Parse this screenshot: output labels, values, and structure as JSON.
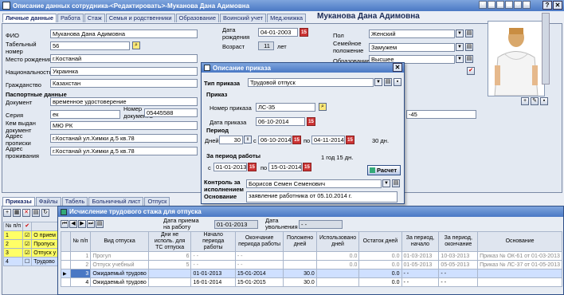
{
  "main_title": "Описание данных сотрудника-<Редактировать>-Муканова Дана Адимовна",
  "employee_header": "Муканова Дана Адимовна",
  "tabs": [
    "Личные данные",
    "Работа",
    "Стаж",
    "Семья и родственники",
    "Образование",
    "Воинский учет",
    "Мед.книжка"
  ],
  "personal": {
    "fio_label": "ФИО",
    "fio": "Муканова Дана Адимовна",
    "tabnum_label": "Табельный номер",
    "tabnum": "56",
    "birthplace_label": "Место рождения",
    "birthplace": "г.Костанай",
    "nation_label": "Национальность",
    "nation": "Украинка",
    "citizen_label": "Гражданство",
    "citizen": "Казахстан",
    "passport_header": "Паспортные данные",
    "doc_label": "Документ",
    "doc": "временное удостоверение",
    "series_label": "Серия",
    "series": "ек",
    "docnum_label": "Номер документа",
    "docnum": "05445588",
    "issuer_label": "Кем выдан документ",
    "issuer": "МЮ РК",
    "reg_label": "Адрес прописки",
    "reg": "г.Костанай ул.Химки д.5 кв.78",
    "live_label": "Адрес проживания",
    "live": "г.Костанай ул.Химки д.5 кв.78",
    "dob_label": "Дата рождения",
    "dob": "04-01-2003",
    "age_label": "Возраст",
    "age": "11",
    "age_unit": "лет",
    "sex_label": "Пол",
    "sex": "Женский",
    "marital_label": "Семейное положение",
    "marital": "Замужем",
    "edu_label": "Образование",
    "edu": "Высшее",
    "right_value": "-45"
  },
  "bottom_tabs": [
    "Приказы",
    "Файлы",
    "Табель",
    "Больничный лист",
    "Отпуск"
  ],
  "orders_grid": {
    "header": [
      "№ п/п"
    ],
    "rows": [
      {
        "n": "1",
        "text": "О прием"
      },
      {
        "n": "2",
        "text": "Пропуск"
      },
      {
        "n": "3",
        "text": "Отпуск у"
      },
      {
        "n": "4",
        "text": "Трудово"
      }
    ]
  },
  "vacation_dialog": {
    "title": "Описание приказа",
    "type_label": "Тип приказа",
    "type": "Трудовой отпуск",
    "order_section": "Приказ",
    "num_label": "Номер приказа",
    "num": "ЛС-35",
    "date_label": "Дата приказа",
    "date": "06-10-2014",
    "period_section": "Период",
    "days_label": "Дней",
    "days": "30",
    "from_label": "с",
    "from": "06-10-2014",
    "to_label": "по",
    "to": "04-11-2014",
    "total": "30 дн.",
    "work_period_section": "За период работы",
    "wp_from_label": "с",
    "wp_from": "01-01-2013",
    "wp_to_label": "по",
    "wp_to": "15-01-2014",
    "wp_len": "1 год 15 дн.",
    "calc_button": "Расчет",
    "control_label": "Контроль за исполнением",
    "control": "Борисов Семен Семенович",
    "basis_label": "Основание",
    "basis": "заявление работника   от 05.10.2014 г."
  },
  "calc_dialog": {
    "title": "Исчисление трудового стажа для отпуска",
    "hire_label": "Дата приема на работу",
    "hire": "01-01-2013",
    "dismiss_label": "Дата увольнения",
    "dismiss": "- -",
    "columns": [
      "№ п/п",
      "Вид отпуска",
      "Дни не исполь. для ТС отпуска",
      "Начало периода работы",
      "Окончание периода работы",
      "Положено дней",
      "Использовано дней",
      "Остаток дней",
      "За период, начало",
      "За период, окончание",
      "Основание"
    ],
    "rows": [
      {
        "n": "1",
        "kind": "Прогул",
        "unused": "6",
        "start": "- -",
        "end": "- -",
        "due": "",
        "used": "0.0",
        "rest": "0.0",
        "pstart": "01-03-2013",
        "pend": "10-03-2013",
        "basis": "Приказ № ОК-61 от 01-03-2013",
        "grey": true
      },
      {
        "n": "2",
        "kind": "Отпуск учебный",
        "unused": "5",
        "start": "- -",
        "end": "- -",
        "due": "",
        "used": "0.0",
        "rest": "0.0",
        "pstart": "01-05-2013",
        "pend": "05-05-2013",
        "basis": "Приказ № ЛС-37 от 01-05-2013",
        "grey": true
      },
      {
        "n": "3",
        "kind": "Ожидаемый трудово",
        "unused": "",
        "start": "01-01-2013",
        "end": "15-01-2014",
        "due": "30.0",
        "used": "",
        "rest": "0.0",
        "pstart": "- -",
        "pend": "- -",
        "basis": "",
        "grey": false,
        "selected": true
      },
      {
        "n": "4",
        "kind": "Ожидаемый трудово",
        "unused": "",
        "start": "16-01-2014",
        "end": "15-01-2015",
        "due": "30.0",
        "used": "",
        "rest": "0.0",
        "pstart": "- -",
        "pend": "- -",
        "basis": "",
        "grey": false
      }
    ]
  }
}
